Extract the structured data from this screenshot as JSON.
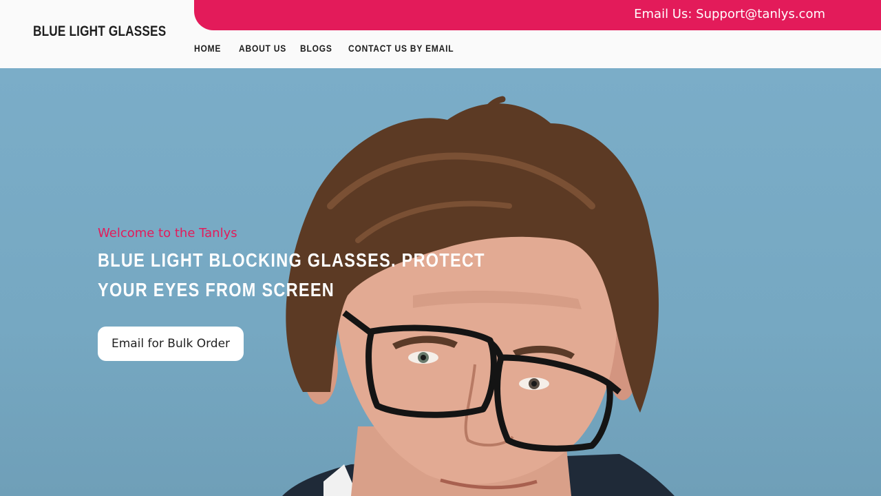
{
  "header": {
    "brand": "BLUE LIGHT GLASSES",
    "topbar_email": "Email Us: Support@tanlys.com",
    "nav": [
      "HOME",
      "ABOUT US",
      "BLOGS",
      "CONTACT US BY EMAIL"
    ]
  },
  "hero": {
    "welcome": "Welcome to the Tanlys",
    "headline": "BLUE LIGHT BLOCKING GLASSES. PROTECT YOUR EYES FROM SCREEN",
    "cta_label": "Email for Bulk Order"
  },
  "colors": {
    "accent": "#e31b5a",
    "hero_background": "#7aaac4",
    "header_background": "#fafafa"
  }
}
